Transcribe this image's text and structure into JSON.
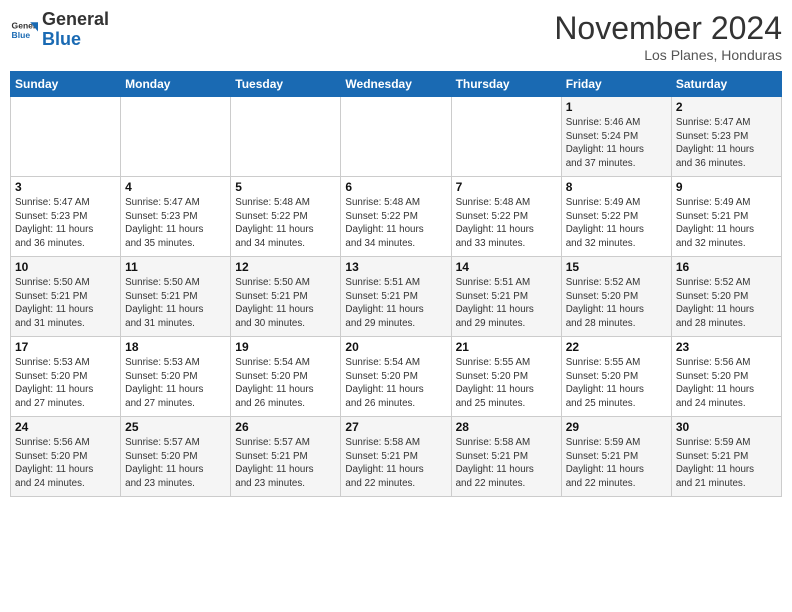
{
  "header": {
    "logo_general": "General",
    "logo_blue": "Blue",
    "month_year": "November 2024",
    "location": "Los Planes, Honduras"
  },
  "weekdays": [
    "Sunday",
    "Monday",
    "Tuesday",
    "Wednesday",
    "Thursday",
    "Friday",
    "Saturday"
  ],
  "weeks": [
    [
      {
        "day": "",
        "info": ""
      },
      {
        "day": "",
        "info": ""
      },
      {
        "day": "",
        "info": ""
      },
      {
        "day": "",
        "info": ""
      },
      {
        "day": "",
        "info": ""
      },
      {
        "day": "1",
        "info": "Sunrise: 5:46 AM\nSunset: 5:24 PM\nDaylight: 11 hours\nand 37 minutes."
      },
      {
        "day": "2",
        "info": "Sunrise: 5:47 AM\nSunset: 5:23 PM\nDaylight: 11 hours\nand 36 minutes."
      }
    ],
    [
      {
        "day": "3",
        "info": "Sunrise: 5:47 AM\nSunset: 5:23 PM\nDaylight: 11 hours\nand 36 minutes."
      },
      {
        "day": "4",
        "info": "Sunrise: 5:47 AM\nSunset: 5:23 PM\nDaylight: 11 hours\nand 35 minutes."
      },
      {
        "day": "5",
        "info": "Sunrise: 5:48 AM\nSunset: 5:22 PM\nDaylight: 11 hours\nand 34 minutes."
      },
      {
        "day": "6",
        "info": "Sunrise: 5:48 AM\nSunset: 5:22 PM\nDaylight: 11 hours\nand 34 minutes."
      },
      {
        "day": "7",
        "info": "Sunrise: 5:48 AM\nSunset: 5:22 PM\nDaylight: 11 hours\nand 33 minutes."
      },
      {
        "day": "8",
        "info": "Sunrise: 5:49 AM\nSunset: 5:22 PM\nDaylight: 11 hours\nand 32 minutes."
      },
      {
        "day": "9",
        "info": "Sunrise: 5:49 AM\nSunset: 5:21 PM\nDaylight: 11 hours\nand 32 minutes."
      }
    ],
    [
      {
        "day": "10",
        "info": "Sunrise: 5:50 AM\nSunset: 5:21 PM\nDaylight: 11 hours\nand 31 minutes."
      },
      {
        "day": "11",
        "info": "Sunrise: 5:50 AM\nSunset: 5:21 PM\nDaylight: 11 hours\nand 31 minutes."
      },
      {
        "day": "12",
        "info": "Sunrise: 5:50 AM\nSunset: 5:21 PM\nDaylight: 11 hours\nand 30 minutes."
      },
      {
        "day": "13",
        "info": "Sunrise: 5:51 AM\nSunset: 5:21 PM\nDaylight: 11 hours\nand 29 minutes."
      },
      {
        "day": "14",
        "info": "Sunrise: 5:51 AM\nSunset: 5:21 PM\nDaylight: 11 hours\nand 29 minutes."
      },
      {
        "day": "15",
        "info": "Sunrise: 5:52 AM\nSunset: 5:20 PM\nDaylight: 11 hours\nand 28 minutes."
      },
      {
        "day": "16",
        "info": "Sunrise: 5:52 AM\nSunset: 5:20 PM\nDaylight: 11 hours\nand 28 minutes."
      }
    ],
    [
      {
        "day": "17",
        "info": "Sunrise: 5:53 AM\nSunset: 5:20 PM\nDaylight: 11 hours\nand 27 minutes."
      },
      {
        "day": "18",
        "info": "Sunrise: 5:53 AM\nSunset: 5:20 PM\nDaylight: 11 hours\nand 27 minutes."
      },
      {
        "day": "19",
        "info": "Sunrise: 5:54 AM\nSunset: 5:20 PM\nDaylight: 11 hours\nand 26 minutes."
      },
      {
        "day": "20",
        "info": "Sunrise: 5:54 AM\nSunset: 5:20 PM\nDaylight: 11 hours\nand 26 minutes."
      },
      {
        "day": "21",
        "info": "Sunrise: 5:55 AM\nSunset: 5:20 PM\nDaylight: 11 hours\nand 25 minutes."
      },
      {
        "day": "22",
        "info": "Sunrise: 5:55 AM\nSunset: 5:20 PM\nDaylight: 11 hours\nand 25 minutes."
      },
      {
        "day": "23",
        "info": "Sunrise: 5:56 AM\nSunset: 5:20 PM\nDaylight: 11 hours\nand 24 minutes."
      }
    ],
    [
      {
        "day": "24",
        "info": "Sunrise: 5:56 AM\nSunset: 5:20 PM\nDaylight: 11 hours\nand 24 minutes."
      },
      {
        "day": "25",
        "info": "Sunrise: 5:57 AM\nSunset: 5:20 PM\nDaylight: 11 hours\nand 23 minutes."
      },
      {
        "day": "26",
        "info": "Sunrise: 5:57 AM\nSunset: 5:21 PM\nDaylight: 11 hours\nand 23 minutes."
      },
      {
        "day": "27",
        "info": "Sunrise: 5:58 AM\nSunset: 5:21 PM\nDaylight: 11 hours\nand 22 minutes."
      },
      {
        "day": "28",
        "info": "Sunrise: 5:58 AM\nSunset: 5:21 PM\nDaylight: 11 hours\nand 22 minutes."
      },
      {
        "day": "29",
        "info": "Sunrise: 5:59 AM\nSunset: 5:21 PM\nDaylight: 11 hours\nand 22 minutes."
      },
      {
        "day": "30",
        "info": "Sunrise: 5:59 AM\nSunset: 5:21 PM\nDaylight: 11 hours\nand 21 minutes."
      }
    ]
  ]
}
